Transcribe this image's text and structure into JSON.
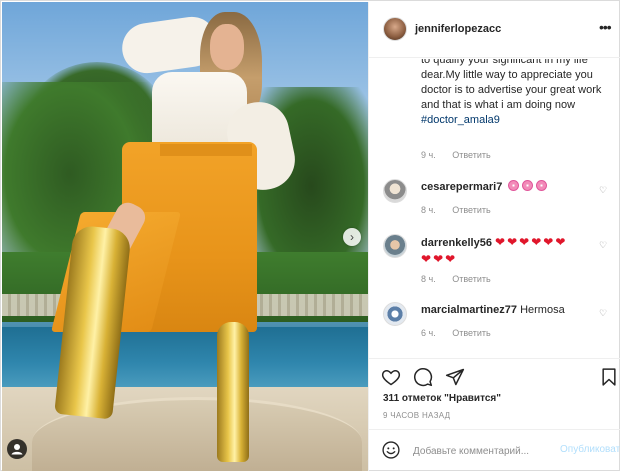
{
  "post": {
    "username": "jenniferlopezacc",
    "more_icon": "more-horizontal-icon"
  },
  "caption": {
    "text": "to qualify your significant in my life dear.My little way to appreciate you doctor is to advertise your great work and that is what i am doing now",
    "hashtag": "#doctor_amala9",
    "age": "9 ч.",
    "reply_label": "Ответить"
  },
  "comments": [
    {
      "username": "cesarepermari7",
      "text": "",
      "emoji": [
        "flower",
        "flower",
        "flower"
      ],
      "age": "8 ч.",
      "reply_label": "Ответить"
    },
    {
      "username": "darrenkelly56",
      "text": "",
      "emoji": [
        "heart",
        "heart",
        "heart",
        "heart",
        "heart",
        "heart",
        "heart",
        "heart",
        "heart"
      ],
      "age": "8 ч.",
      "reply_label": "Ответить"
    },
    {
      "username": "marcialmartinez77",
      "text": "Hermosa",
      "age": "6 ч.",
      "reply_label": "Ответить"
    }
  ],
  "actions": {
    "like_icon": "heart-outline-icon",
    "comment_icon": "comment-icon",
    "share_icon": "paper-plane-icon",
    "save_icon": "bookmark-icon"
  },
  "likes_text": "311 отметок \"Нравится\"",
  "timestamp_text": "9 ЧАСОВ НАЗАД",
  "add_comment": {
    "placeholder": "Добавьте комментарий...",
    "post_label": "Опубликовать"
  },
  "photo": {
    "next_glyph": "›",
    "user_tag_glyph": "●"
  },
  "colors": {
    "hashtag": "#00376b",
    "meta": "#8e8e8e",
    "post_disabled": "#b2dffc",
    "heart_red": "#e0162b"
  }
}
